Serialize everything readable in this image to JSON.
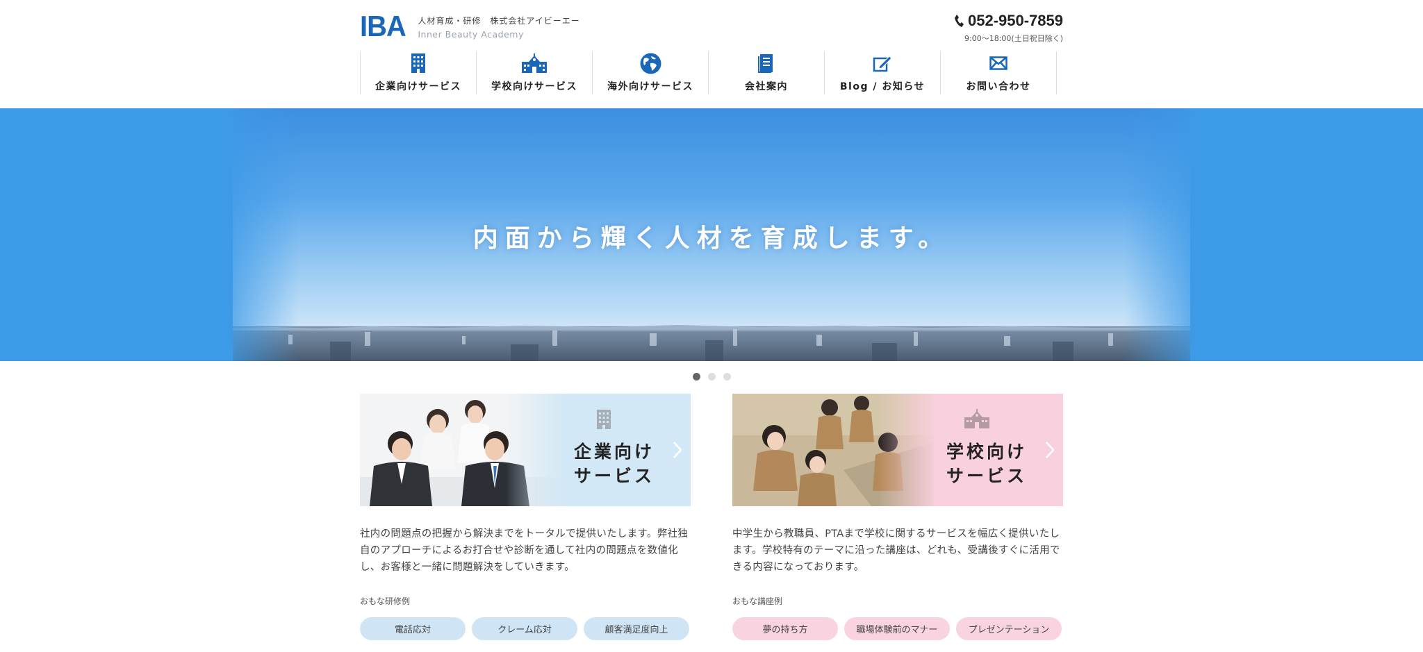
{
  "header": {
    "logo_mark": "IBA",
    "logo_tagline": "人材育成・研修　株式会社アイビーエー",
    "logo_english": "Inner Beauty Academy",
    "tel_number": "052-950-7859",
    "tel_hours": "9:00〜18:00(土日祝日除く)"
  },
  "nav": {
    "items": [
      {
        "label": "企業向けサービス",
        "icon": "building-icon"
      },
      {
        "label": "学校向けサービス",
        "icon": "school-icon"
      },
      {
        "label": "海外向けサービス",
        "icon": "globe-icon"
      },
      {
        "label": "会社案内",
        "icon": "document-icon"
      },
      {
        "label": "Blog / お知らせ",
        "icon": "pencil-edit-icon"
      },
      {
        "label": "お問い合わせ",
        "icon": "envelope-icon"
      }
    ]
  },
  "hero": {
    "copy": "内面から輝く人材を育成します。",
    "slide_count": 3,
    "active_slide": 1
  },
  "services": [
    {
      "title_line1": "企業向け",
      "title_line2": "サービス",
      "description": "社内の問題点の把握から解決までをトータルで提供いたします。弊社独自のアプローチによるお打合せや診断を通して社内の問題点を数値化し、お客様と一緒に問題解決をしていきます。",
      "examples_label": "おもな研修例",
      "tags": [
        "電話応対",
        "クレーム応対",
        "顧客満足度向上"
      ],
      "accent": "#d3e8f6"
    },
    {
      "title_line1": "学校向け",
      "title_line2": "サービス",
      "description": "中学生から教職員、PTAまで学校に関するサービスを幅広く提供いたします。学校特有のテーマに沿った講座は、どれも、受講後すぐに活用できる内容になっております。",
      "examples_label": "おもな講座例",
      "tags": [
        "夢の持ち方",
        "職場体験前のマナー",
        "プレゼンテーション"
      ],
      "accent": "#f9d0dd"
    }
  ],
  "colors": {
    "brand": "#1a67b9",
    "hero_sky": "#3d9ae7"
  }
}
